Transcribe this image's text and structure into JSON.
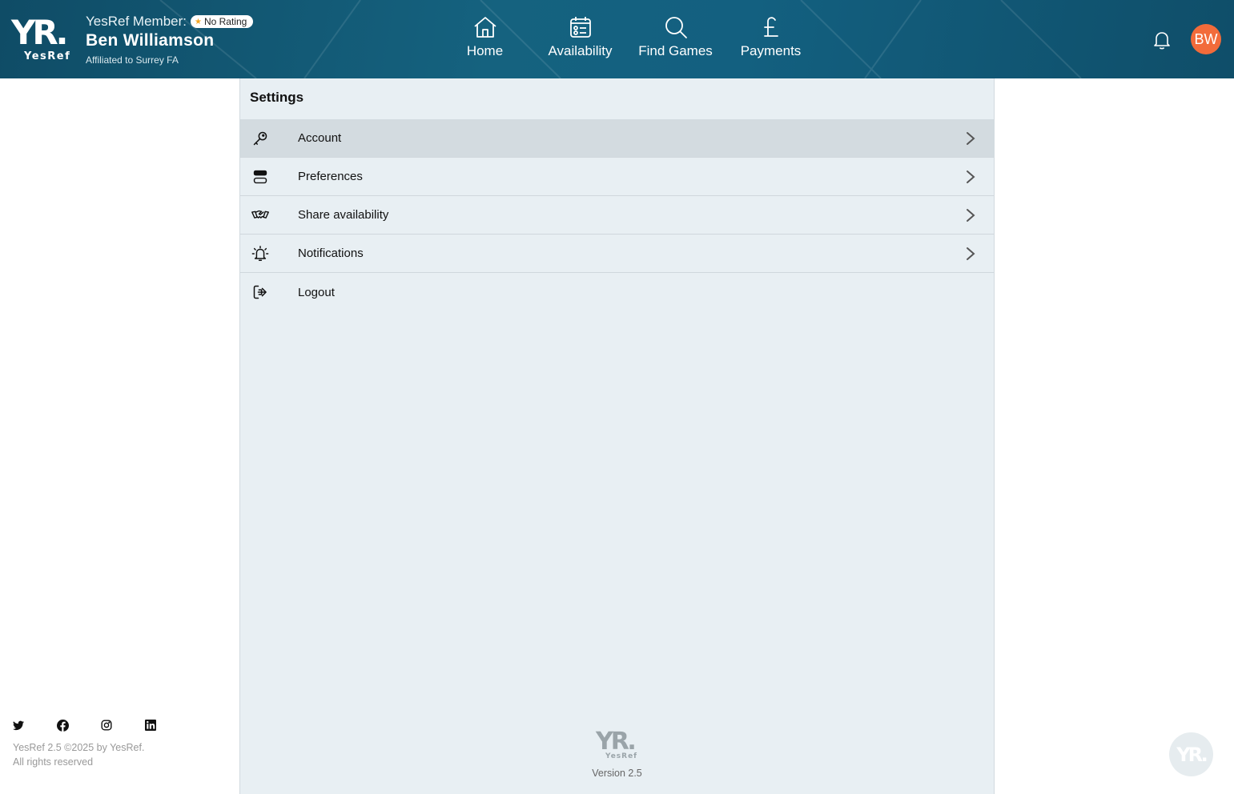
{
  "brand": {
    "logo_mark": "YR.",
    "logo_word": "YesRef"
  },
  "member": {
    "label": "YesRef Member:",
    "rating": "No Rating",
    "name": "Ben Williamson",
    "affiliation": "Affiliated to Surrey FA"
  },
  "nav": {
    "items": [
      {
        "label": "Home",
        "icon": "home-icon"
      },
      {
        "label": "Availability",
        "icon": "calendar-icon"
      },
      {
        "label": "Find Games",
        "icon": "search-icon"
      },
      {
        "label": "Payments",
        "icon": "pound-icon"
      }
    ]
  },
  "user": {
    "initials": "BW",
    "avatar_color": "#f26b3a"
  },
  "settings": {
    "title": "Settings",
    "items": [
      {
        "label": "Account",
        "icon": "key-icon"
      },
      {
        "label": "Preferences",
        "icon": "toggle-icon"
      },
      {
        "label": "Share availability",
        "icon": "handshake-icon"
      },
      {
        "label": "Notifications",
        "icon": "bell-ring-icon"
      },
      {
        "label": "Logout",
        "icon": "logout-icon"
      }
    ]
  },
  "footer": {
    "copyright_line1": "YesRef 2.5 ©2025 by YesRef.",
    "copyright_line2": "All rights reserved",
    "version": "Version 2.5",
    "social": [
      "twitter-icon",
      "facebook-icon",
      "instagram-icon",
      "linkedin-icon"
    ]
  },
  "colors": {
    "header": "#15627f",
    "panel": "#e8eff3",
    "active_row": "#d3dbe0",
    "accent": "#f26b3a"
  }
}
